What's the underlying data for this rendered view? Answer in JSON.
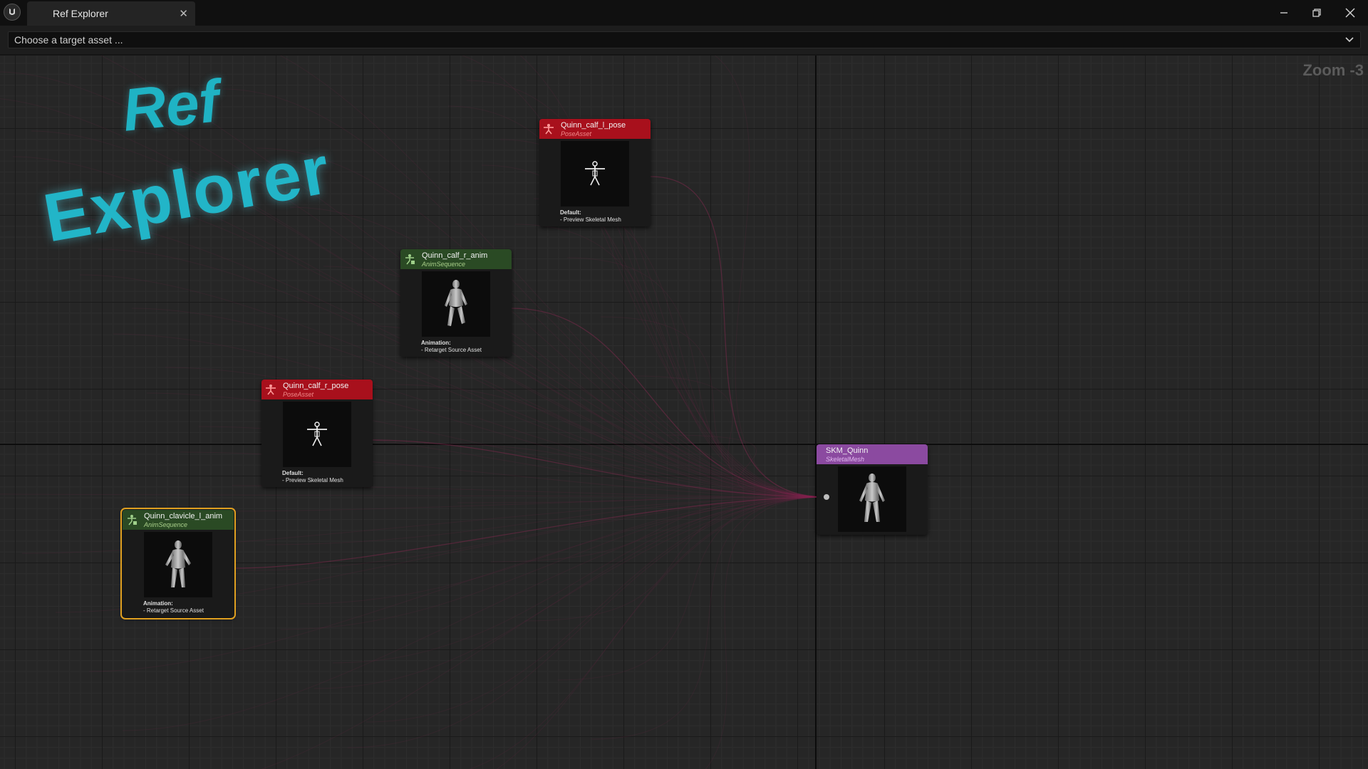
{
  "window": {
    "tab_title": "Ref Explorer",
    "tab_close": "✕",
    "minimize": "–",
    "restore": "❐",
    "close": "✕"
  },
  "toolbar": {
    "target_asset_placeholder": "Choose a target asset ..."
  },
  "graph": {
    "zoom_label": "Zoom -3",
    "logo": {
      "line1": "Ref",
      "line2": "Explorer"
    },
    "colors": {
      "pose_asset": "#a8101c",
      "anim_sequence": "#2a4a24",
      "skeletal_mesh": "#8b4aa0",
      "selection": "#e0a020",
      "wire": "#8a2a52"
    },
    "nodes": [
      {
        "title": "Quinn_calf_l_pose",
        "type": "PoseAsset",
        "icon": "pose-asset-icon",
        "thumbnail": "skeleton-t-pose",
        "info_heading": "Default:",
        "info_item": " - Preview Skeletal Mesh"
      },
      {
        "title": "Quinn_calf_r_anim",
        "type": "AnimSequence",
        "icon": "anim-sequence-icon",
        "thumbnail": "mannequin",
        "info_heading": "Animation:",
        "info_item": " - Retarget Source Asset"
      },
      {
        "title": "Quinn_calf_r_pose",
        "type": "PoseAsset",
        "icon": "pose-asset-icon",
        "thumbnail": "skeleton-t-pose",
        "info_heading": "Default:",
        "info_item": " - Preview Skeletal Mesh"
      },
      {
        "title": "Quinn_clavicle_l_anim",
        "type": "AnimSequence",
        "icon": "anim-sequence-icon",
        "thumbnail": "mannequin",
        "info_heading": "Animation:",
        "info_item": " - Retarget Source Asset",
        "selected": true
      },
      {
        "title": "SKM_Quinn",
        "type": "SkeletalMesh",
        "icon": "skeletal-mesh-icon",
        "thumbnail": "mannequin"
      }
    ]
  }
}
